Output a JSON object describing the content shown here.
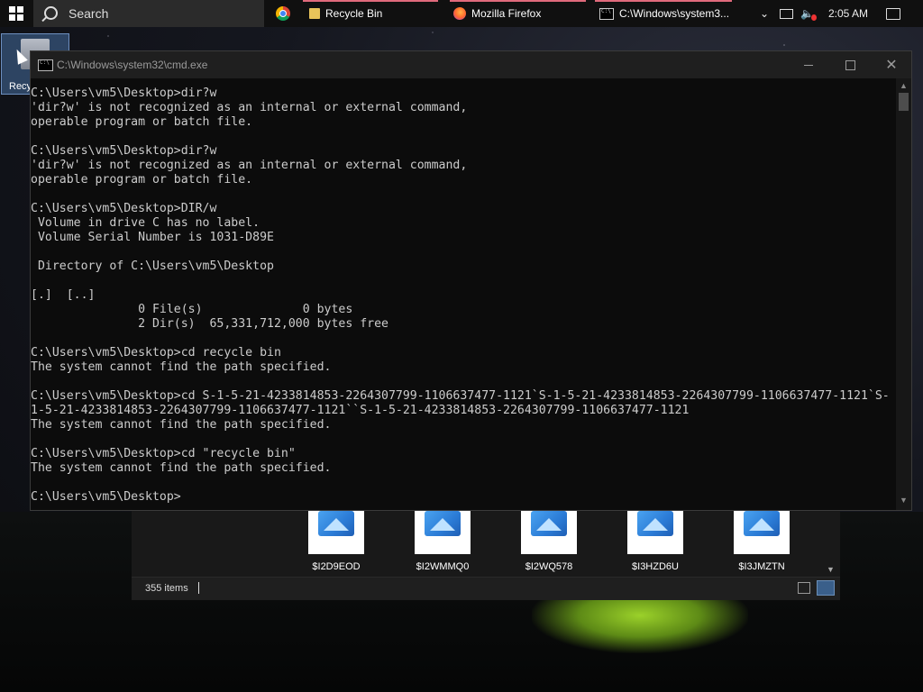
{
  "taskbar": {
    "search_label": "Search",
    "apps": [
      {
        "label": "Recycle Bin",
        "icon": "folder-icon"
      },
      {
        "label": "Mozilla Firefox",
        "icon": "firefox-icon"
      },
      {
        "label": "C:\\Windows\\system3...",
        "icon": "cmd-icon"
      }
    ],
    "clock": "2:05 AM"
  },
  "desktop": {
    "recycle_bin_label": "Recy"
  },
  "cmd_window": {
    "title": "C:\\Windows\\system32\\cmd.exe",
    "lines": [
      "C:\\Users\\vm5\\Desktop>dir?w",
      "'dir?w' is not recognized as an internal or external command,",
      "operable program or batch file.",
      "",
      "C:\\Users\\vm5\\Desktop>dir?w",
      "'dir?w' is not recognized as an internal or external command,",
      "operable program or batch file.",
      "",
      "C:\\Users\\vm5\\Desktop>DIR/w",
      " Volume in drive C has no label.",
      " Volume Serial Number is 1031-D89E",
      "",
      " Directory of C:\\Users\\vm5\\Desktop",
      "",
      "[.]  [..]",
      "               0 File(s)              0 bytes",
      "               2 Dir(s)  65,331,712,000 bytes free",
      "",
      "C:\\Users\\vm5\\Desktop>cd recycle bin",
      "The system cannot find the path specified.",
      "",
      "C:\\Users\\vm5\\Desktop>cd S-1-5-21-4233814853-2264307799-1106637477-1121`S-1-5-21-4233814853-2264307799-1106637477-1121`S-",
      "1-5-21-4233814853-2264307799-1106637477-1121``S-1-5-21-4233814853-2264307799-1106637477-1121",
      "The system cannot find the path specified.",
      "",
      "C:\\Users\\vm5\\Desktop>cd \"recycle bin\"",
      "The system cannot find the path specified.",
      "",
      "C:\\Users\\vm5\\Desktop>"
    ]
  },
  "explorer": {
    "files": [
      "$I2D9EOD",
      "$I2WMMQ0",
      "$I2WQ578",
      "$I3HZD6U",
      "$I3JMZTN"
    ],
    "status_items": "355 items"
  }
}
